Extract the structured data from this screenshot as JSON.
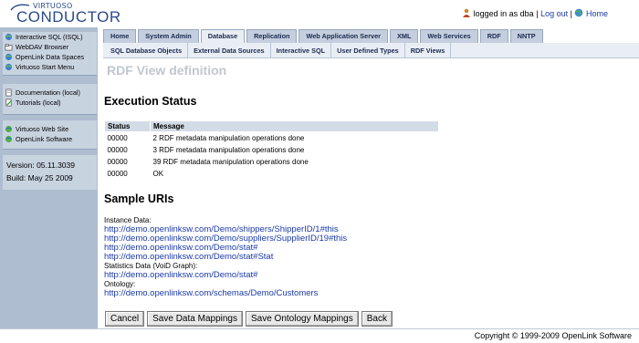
{
  "app": {
    "logo_small": "VIRTUOSO",
    "logo_big": "CONDUCTOR"
  },
  "userbar": {
    "logged_in_text": "logged in as dba",
    "logout_label": "Log out",
    "home_label": "Home"
  },
  "sidebar": {
    "group1": [
      {
        "label": "Interactive SQL (ISQL)",
        "icon": "globe-icon"
      },
      {
        "label": "WebDAV Browser",
        "icon": "folder-icon"
      },
      {
        "label": "OpenLink Data Spaces",
        "icon": "globe-icon"
      },
      {
        "label": "Virtuoso Start Menu",
        "icon": "globe-icon"
      }
    ],
    "group2": [
      {
        "label": "Documentation (local)",
        "icon": "document-icon"
      },
      {
        "label": "Tutorials (local)",
        "icon": "pencil-icon"
      }
    ],
    "group3": [
      {
        "label": "Virtuoso Web Site",
        "icon": "globe-icon"
      },
      {
        "label": "OpenLink Software",
        "icon": "globe-icon"
      }
    ],
    "version": "Version: 05.11.3039",
    "build": "Build: May 25 2009"
  },
  "tabs": [
    "Home",
    "System Admin",
    "Database",
    "Replication",
    "Web Application Server",
    "XML",
    "Web Services",
    "RDF",
    "NNTP"
  ],
  "active_tab": "Database",
  "subtabs": [
    "SQL Database Objects",
    "External Data Sources",
    "Interactive SQL",
    "User Defined Types",
    "RDF Views"
  ],
  "page_title": "RDF View definition",
  "execution": {
    "heading": "Execution Status",
    "headers": [
      "Status",
      "Message"
    ],
    "rows": [
      [
        "00000",
        "2 RDF metadata manipulation operations done"
      ],
      [
        "00000",
        "3 RDF metadata manipulation operations done"
      ],
      [
        "00000",
        "39 RDF metadata manipulation operations done"
      ],
      [
        "00000",
        "OK"
      ]
    ]
  },
  "sample": {
    "heading": "Sample URIs",
    "instance_label": "Instance Data:",
    "instance_links": [
      "http://demo.openlinksw.com/Demo/shippers/ShipperID/1#this",
      "http://demo.openlinksw.com/Demo/suppliers/SupplierID/19#this",
      "http://demo.openlinksw.com/Demo/stat#",
      "http://demo.openlinksw.com/Demo/stat#Stat"
    ],
    "stats_label": "Statistics Data (VoiD Graph):",
    "stats_link": "http://demo.openlinksw.com/Demo/stat#",
    "ontology_label": "Ontology:",
    "ontology_link": "http://demo.openlinksw.com/schemas/Demo/Customers"
  },
  "buttons": {
    "cancel": "Cancel",
    "save_data": "Save Data Mappings",
    "save_ontology": "Save Ontology Mappings",
    "back": "Back"
  },
  "footer": "Copyright © 1999-2009 OpenLink Software"
}
